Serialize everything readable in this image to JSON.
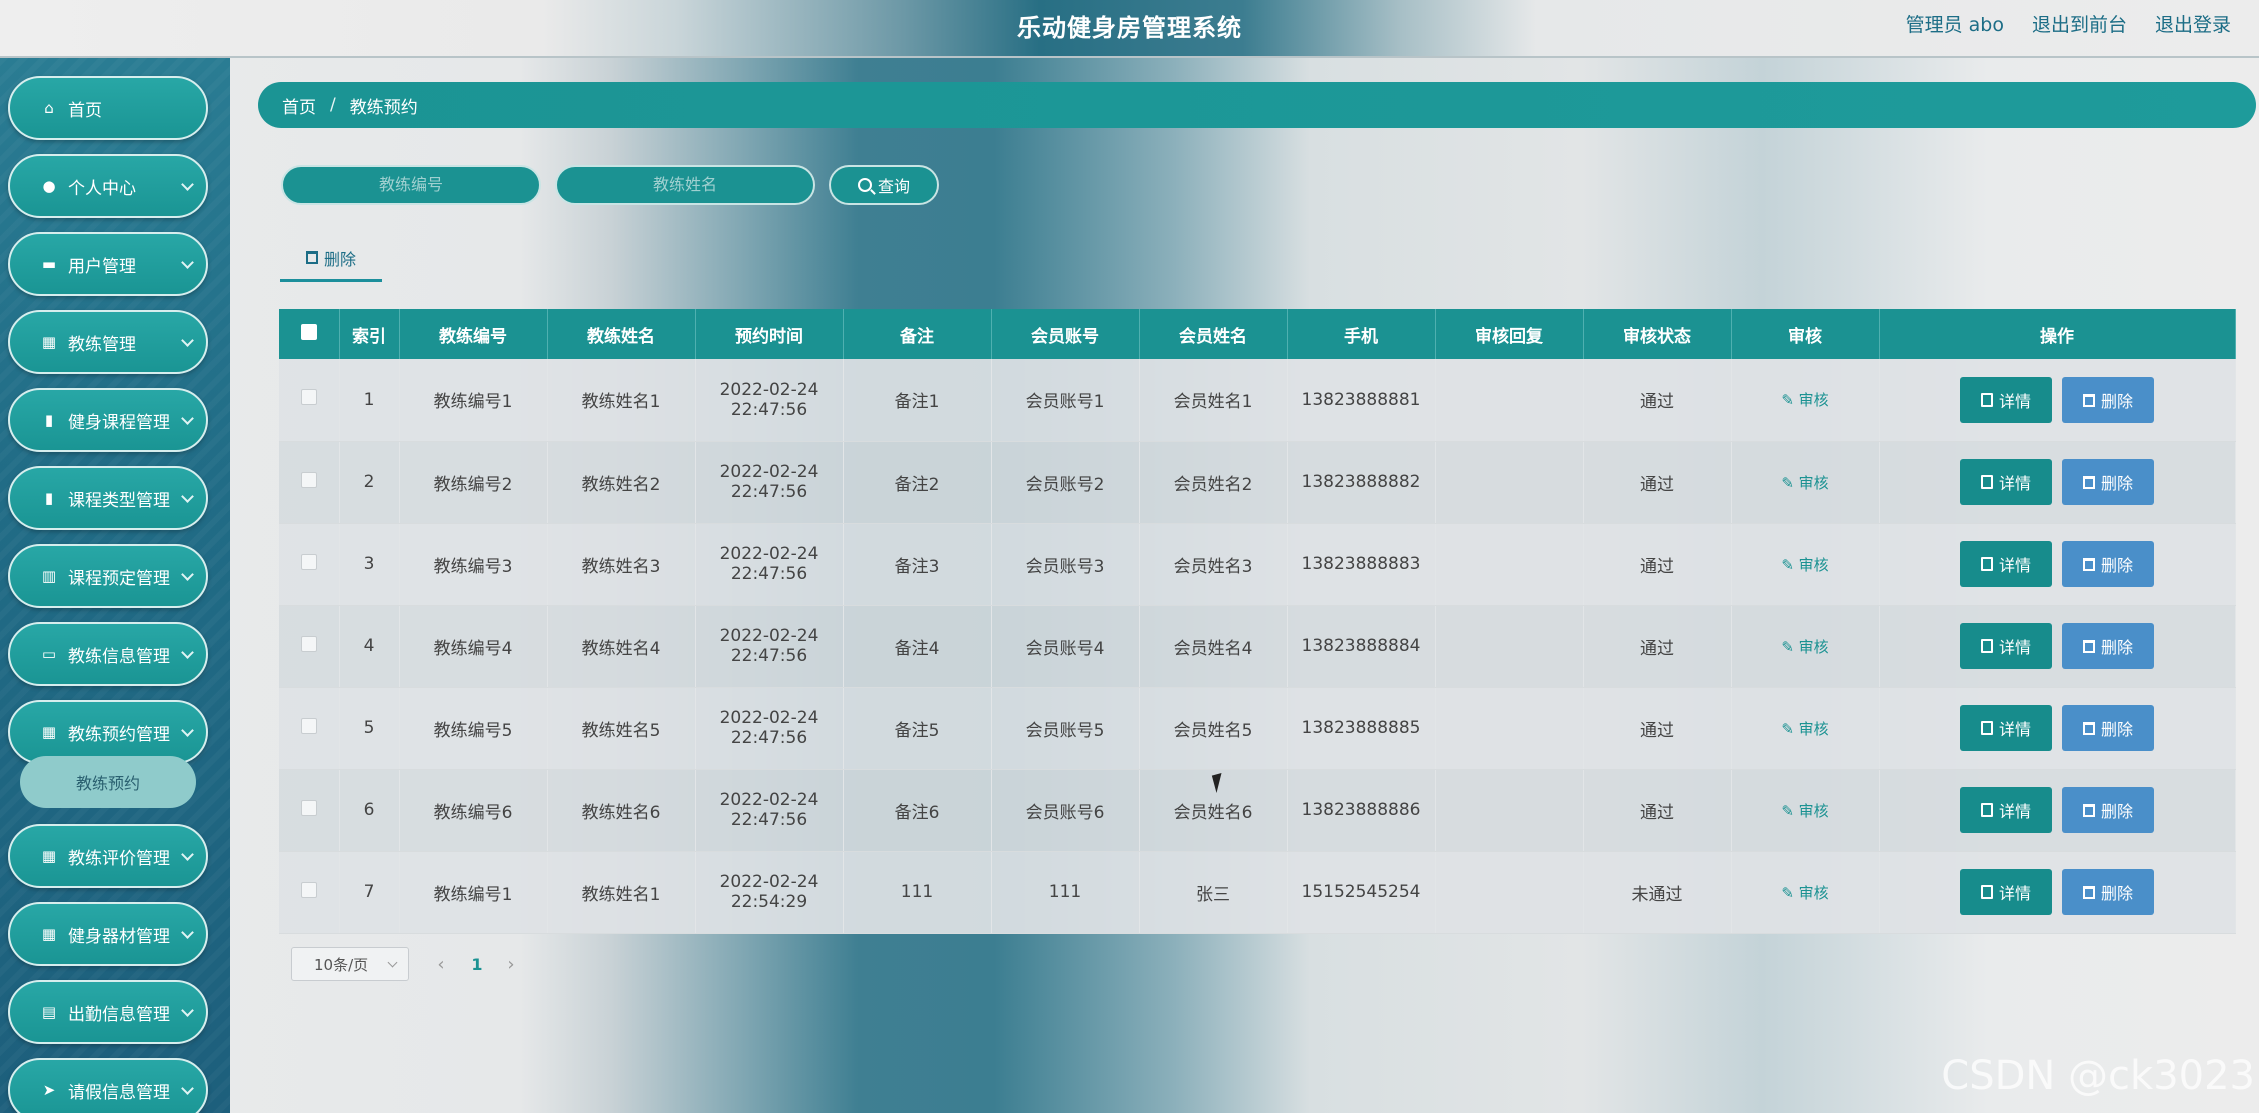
{
  "header": {
    "title": "乐动健身房管理系统",
    "user": "管理员 abo",
    "back_front": "退出到前台",
    "logout": "退出登录"
  },
  "sidebar": {
    "items": [
      {
        "label": "首页",
        "icon": "home-icon"
      },
      {
        "label": "个人中心",
        "icon": "user-icon"
      },
      {
        "label": "用户管理",
        "icon": "briefcase-icon"
      },
      {
        "label": "教练管理",
        "icon": "grid-icon"
      },
      {
        "label": "健身课程管理",
        "icon": "clipboard-icon"
      },
      {
        "label": "课程类型管理",
        "icon": "clipboard-icon"
      },
      {
        "label": "课程预定管理",
        "icon": "chart-icon"
      },
      {
        "label": "教练信息管理",
        "icon": "board-icon"
      },
      {
        "label": "教练预约管理",
        "icon": "grid-icon"
      },
      {
        "label": "教练评价管理",
        "icon": "grid-icon"
      },
      {
        "label": "健身器材管理",
        "icon": "grid-icon"
      },
      {
        "label": "出勤信息管理",
        "icon": "printer-icon"
      },
      {
        "label": "请假信息管理",
        "icon": "send-icon"
      }
    ],
    "active_sub": "教练预约"
  },
  "breadcrumb": {
    "home": "首页",
    "sep": "/",
    "current": "教练预约"
  },
  "search": {
    "coach_no_placeholder": "教练编号",
    "coach_name_placeholder": "教练姓名",
    "query_label": "查询"
  },
  "toolbar": {
    "delete_label": "删除"
  },
  "table": {
    "headers": [
      "索引",
      "教练编号",
      "教练姓名",
      "预约时间",
      "备注",
      "会员账号",
      "会员姓名",
      "手机",
      "审核回复",
      "审核状态",
      "审核",
      "操作"
    ],
    "rows": [
      {
        "index": "1",
        "coach_no": "教练编号1",
        "coach_name": "教练姓名1",
        "time": "2022-02-24 22:47:56",
        "note": "备注1",
        "member_acct": "会员账号1",
        "member_name": "会员姓名1",
        "phone": "13823888881",
        "reply": "",
        "status": "通过"
      },
      {
        "index": "2",
        "coach_no": "教练编号2",
        "coach_name": "教练姓名2",
        "time": "2022-02-24 22:47:56",
        "note": "备注2",
        "member_acct": "会员账号2",
        "member_name": "会员姓名2",
        "phone": "13823888882",
        "reply": "",
        "status": "通过"
      },
      {
        "index": "3",
        "coach_no": "教练编号3",
        "coach_name": "教练姓名3",
        "time": "2022-02-24 22:47:56",
        "note": "备注3",
        "member_acct": "会员账号3",
        "member_name": "会员姓名3",
        "phone": "13823888883",
        "reply": "",
        "status": "通过"
      },
      {
        "index": "4",
        "coach_no": "教练编号4",
        "coach_name": "教练姓名4",
        "time": "2022-02-24 22:47:56",
        "note": "备注4",
        "member_acct": "会员账号4",
        "member_name": "会员姓名4",
        "phone": "13823888884",
        "reply": "",
        "status": "通过"
      },
      {
        "index": "5",
        "coach_no": "教练编号5",
        "coach_name": "教练姓名5",
        "time": "2022-02-24 22:47:56",
        "note": "备注5",
        "member_acct": "会员账号5",
        "member_name": "会员姓名5",
        "phone": "13823888885",
        "reply": "",
        "status": "通过"
      },
      {
        "index": "6",
        "coach_no": "教练编号6",
        "coach_name": "教练姓名6",
        "time": "2022-02-24 22:47:56",
        "note": "备注6",
        "member_acct": "会员账号6",
        "member_name": "会员姓名6",
        "phone": "13823888886",
        "reply": "",
        "status": "通过"
      },
      {
        "index": "7",
        "coach_no": "教练编号1",
        "coach_name": "教练姓名1",
        "time": "2022-02-24 22:54:29",
        "note": "111",
        "member_acct": "111",
        "member_name": "张三",
        "phone": "15152545254",
        "reply": "",
        "status": "未通过"
      }
    ],
    "audit_label": "审核",
    "detail_label": "详情",
    "delete_label": "删除"
  },
  "pagination": {
    "page_size": "10条/页",
    "current_page": "1"
  },
  "watermark": "CSDN @ck3023"
}
